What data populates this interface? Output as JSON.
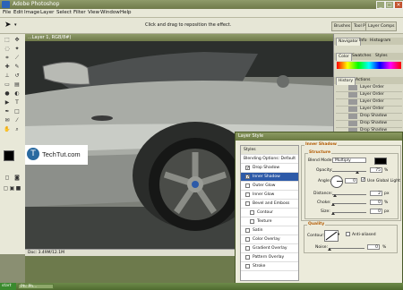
{
  "window": {
    "title": "Adobe Photoshop"
  },
  "menu": [
    "File",
    "Edit",
    "Image",
    "Layer",
    "Select",
    "Filter",
    "View",
    "Window",
    "Help"
  ],
  "options_bar": {
    "hint": "Click and drag to reposition the effect.",
    "tabs": [
      "Brushes",
      "Tool Pr",
      "Layer Comps"
    ]
  },
  "document": {
    "title": "...Layer 1, RGB/8#)"
  },
  "status": {
    "doc_size": "Doc: 3.49M/12.1M"
  },
  "watermark": {
    "text": "TechTut.com"
  },
  "navigator_tabs": [
    "Navigator",
    "Info",
    "Histogram"
  ],
  "color_tabs": [
    "Color",
    "Swatches",
    "Styles"
  ],
  "history_tabs": [
    "History",
    "Actions"
  ],
  "history_items": [
    "Layer Order",
    "Layer Order",
    "Layer Order",
    "Layer Order",
    "Drop Shadow",
    "Drop Shadow",
    "Drop Shadow"
  ],
  "dialog": {
    "title": "Layer Style",
    "list_header": "Styles",
    "blending_options": "Blending Options: Default",
    "styles": [
      {
        "label": "Drop Shadow",
        "checked": true
      },
      {
        "label": "Inner Shadow",
        "checked": true,
        "selected": true
      },
      {
        "label": "Outer Glow",
        "checked": false
      },
      {
        "label": "Inner Glow",
        "checked": false
      },
      {
        "label": "Bevel and Emboss",
        "checked": false
      },
      {
        "label": "Contour",
        "checked": false
      },
      {
        "label": "Texture",
        "checked": false
      },
      {
        "label": "Satin",
        "checked": false
      },
      {
        "label": "Color Overlay",
        "checked": false
      },
      {
        "label": "Gradient Overlay",
        "checked": false
      },
      {
        "label": "Pattern Overlay",
        "checked": false
      },
      {
        "label": "Stroke",
        "checked": false
      }
    ],
    "section_title": "Inner Shadow",
    "structure": {
      "legend": "Structure",
      "blend_mode_label": "Blend Mode:",
      "blend_mode_value": "Multiply",
      "opacity_label": "Opacity:",
      "opacity_value": "75",
      "angle_label": "Angle:",
      "angle_value": "0",
      "global_light_label": "Use Global Light",
      "global_light_checked": true,
      "distance_label": "Distance:",
      "distance_value": "2",
      "choke_label": "Choke:",
      "choke_value": "0",
      "size_label": "Size:",
      "size_value": "0",
      "unit_px": "px",
      "unit_pct": "%"
    },
    "quality": {
      "legend": "Quality",
      "contour_label": "Contour:",
      "antialiased_label": "Anti-aliased",
      "antialiased_checked": false,
      "noise_label": "Noise:",
      "noise_value": "0"
    }
  },
  "taskbar": {
    "start": "start",
    "item": "Ph: Ph..."
  },
  "colors": {
    "titlebar": "#7a8656",
    "selection": "#2d5aa8",
    "accent_orange": "#b35a00"
  }
}
